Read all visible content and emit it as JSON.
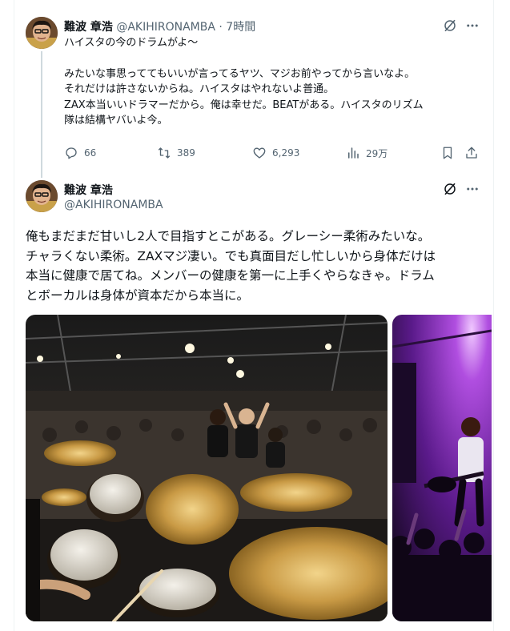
{
  "tweet1": {
    "name": "難波 章浩",
    "handle": "@AKIHIRONAMBA",
    "separator": "·",
    "time": "7時間",
    "text": "ハイスタの今のドラムがよ〜\n\nみたいな事思っててもいいが言ってるヤツ、マジお前やってから言いなよ。\nそれだけは許さないからね。ハイスタはやれないよ普通。\nZAX本当いいドラマーだから。俺は幸せだ。BEATがある。ハイスタのリズム\n隊は結構ヤバいよ今。",
    "actions": {
      "replies": "66",
      "reposts": "389",
      "likes": "6,293",
      "views": "29万"
    }
  },
  "tweet2": {
    "name": "難波 章浩",
    "handle": "@AKIHIRONAMBA",
    "text": "俺もまだまだ甘いし2人で目指すとこがある。グレーシー柔術みたいな。\nチャラくない柔術。ZAXマジ凄い。でも真面目だし忙しいから身体だけは\n本当に健康で居てね。メンバーの健康を第一に上手くやらなきゃ。ドラム\nとボーカルは身体が資本だから本当に。"
  },
  "icons": {
    "grok": "grok-icon",
    "more": "more-icon",
    "reply": "reply-icon",
    "repost": "repost-icon",
    "like": "heart-icon",
    "views": "views-icon",
    "bookmark": "bookmark-icon",
    "share": "share-icon"
  },
  "colors": {
    "text": "#0f1419",
    "muted": "#536471",
    "thread_line": "#cfd9de"
  }
}
